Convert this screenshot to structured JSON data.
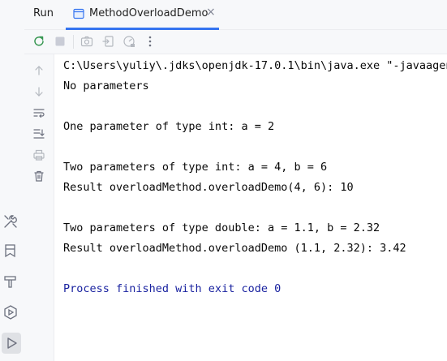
{
  "header": {
    "run_label": "Run",
    "tab": {
      "label": "MethodOverloadDemo",
      "close_glyph": "×"
    }
  },
  "colors": {
    "accent": "#3574f0",
    "rerun_green": "#369650",
    "exit_text": "#1a23a0",
    "text": "#080808"
  },
  "toolbar": {
    "buttons": [
      "rerun-icon",
      "stop-icon",
      "camera-icon",
      "exit-icon",
      "gauge-icon",
      "more-icon"
    ]
  },
  "gutter": {
    "buttons": [
      "arrow-up-icon",
      "arrow-down-icon",
      "soft-wrap-icon",
      "scroll-to-end-icon",
      "print-icon",
      "trash-icon"
    ]
  },
  "sidebar": {
    "buttons": [
      "build-tools-icon",
      "bookmark-icon",
      "hammer-icon",
      "services-icon",
      "run-icon"
    ]
  },
  "console": {
    "lines": [
      "C:\\Users\\yuliy\\.jdks\\openjdk-17.0.1\\bin\\java.exe \"-javaagent",
      "No parameters",
      "",
      "One parameter of type int: a = 2",
      "",
      "Two parameters of type int: a = 4, b = 6",
      "Result overloadMethod.overloadDemo(4, 6): 10",
      "",
      "Two parameters of type double: a = 1.1, b = 2.32",
      "Result overloadMethod.overloadDemo (1.1, 2.32): 3.42",
      "",
      "Process finished with exit code 0"
    ]
  }
}
